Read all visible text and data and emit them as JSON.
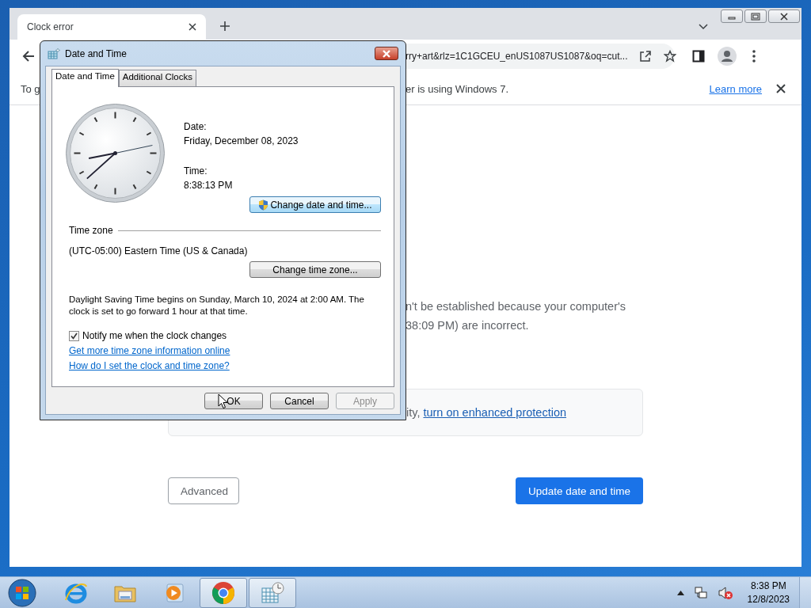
{
  "browser": {
    "tabs": [
      {
        "label": "Clock error",
        "selected": true
      }
    ],
    "address": "rry+art&rlz=1C1GCEU_enUS1087US1087&oq=cut...",
    "infobar": {
      "text_start": "To g",
      "text_end": "er is using Windows 7.",
      "link": "Learn more"
    },
    "page": {
      "paragraph_lines": [
        "n't be established because your computer's",
        "38:09 PM) are incorrect."
      ],
      "notice": {
        "text": "ity,",
        "link": "turn on enhanced protection"
      },
      "buttons": [
        {
          "label": "Advanced",
          "kind": "secondary"
        },
        {
          "label": "Update date and time",
          "kind": "primary"
        }
      ]
    }
  },
  "dialog": {
    "title": "Date and Time",
    "tabs": [
      {
        "label": "Date and Time",
        "selected": true
      },
      {
        "label": "Additional Clocks",
        "selected": false
      }
    ],
    "date_label": "Date:",
    "date": "Friday, December 08, 2023",
    "time_label": "Time:",
    "time": "8:38:13 PM",
    "change_datetime": "Change date and time...",
    "timezone_heading": "Time zone",
    "timezone": "(UTC-05:00) Eastern Time (US & Canada)",
    "change_timezone": "Change time zone...",
    "dst_note": "Daylight Saving Time begins on Sunday, March 10, 2024 at 2:00 AM. The clock is set to go forward 1 hour at that time.",
    "notify": {
      "label": "Notify me when the clock changes",
      "checked": true
    },
    "links": [
      "Get more time zone information online",
      "How do I set the clock and time zone?"
    ],
    "buttons": [
      {
        "label": "OK",
        "disabled": false
      },
      {
        "label": "Cancel",
        "disabled": false
      },
      {
        "label": "Apply",
        "disabled": true
      }
    ]
  },
  "taskbar": {
    "apps": [
      {
        "kind": "ie",
        "selected": false
      },
      {
        "kind": "folder",
        "selected": false
      },
      {
        "kind": "media",
        "selected": false
      },
      {
        "kind": "chrome",
        "selected": true
      },
      {
        "kind": "datetime",
        "selected": true
      }
    ],
    "clock": {
      "time": "8:38 PM",
      "date": "12/8/2023"
    }
  }
}
